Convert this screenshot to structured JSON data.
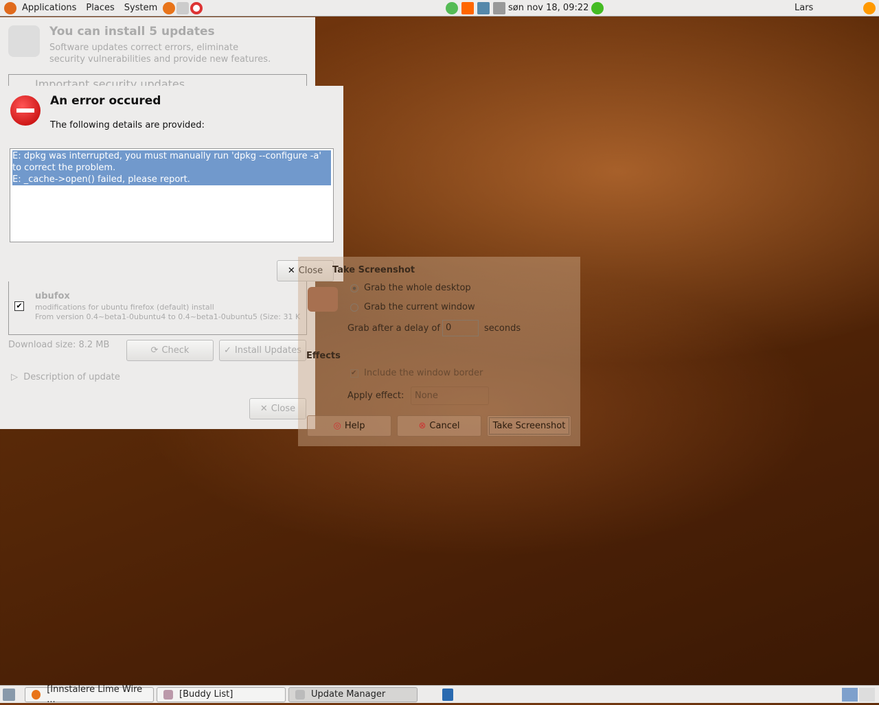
{
  "top_panel": {
    "menus": [
      "Applications",
      "Places",
      "System"
    ],
    "clock": "søn nov 18, 09:22",
    "user": "Lars"
  },
  "update_manager": {
    "title": "You can install 5 updates",
    "subtitle_line1": "Software updates correct errors, eliminate",
    "subtitle_line2": "security vulnerabilities and provide new features.",
    "section": "Important security updates",
    "item": {
      "name": "ubufox",
      "desc": "modifications for ubuntu firefox (default) install",
      "version": "From version 0.4~beta1-0ubuntu4 to 0.4~beta1-0ubuntu5 (Size: 31 K",
      "checked": true
    },
    "download_size": "Download size: 8.2 MB",
    "check": "Check",
    "install": "Install Updates",
    "description": "Description of update",
    "close": "Close"
  },
  "error_dialog": {
    "title": "An error occured",
    "subtitle": "The following details are provided:",
    "details": [
      "E: dpkg was interrupted, you must manually run 'dpkg --configure -a' to correct the problem.",
      "E: _cache->open() failed, please report."
    ],
    "close": "Close"
  },
  "screenshot_dialog": {
    "heading": "Take Screenshot",
    "opt_desktop": "Grab the whole desktop",
    "opt_window": "Grab the current window",
    "delay_pre": "Grab after a delay of",
    "delay_value": "0",
    "delay_post": "seconds",
    "effects": "Effects",
    "include_border": "Include the window border",
    "apply_effect": "Apply effect:",
    "effect_value": "None",
    "help": "Help",
    "cancel": "Cancel",
    "take": "Take Screenshot"
  },
  "taskbar": {
    "tasks": [
      "[Innstalere Lime Wire ...",
      "[Buddy List]",
      "Update Manager"
    ]
  }
}
